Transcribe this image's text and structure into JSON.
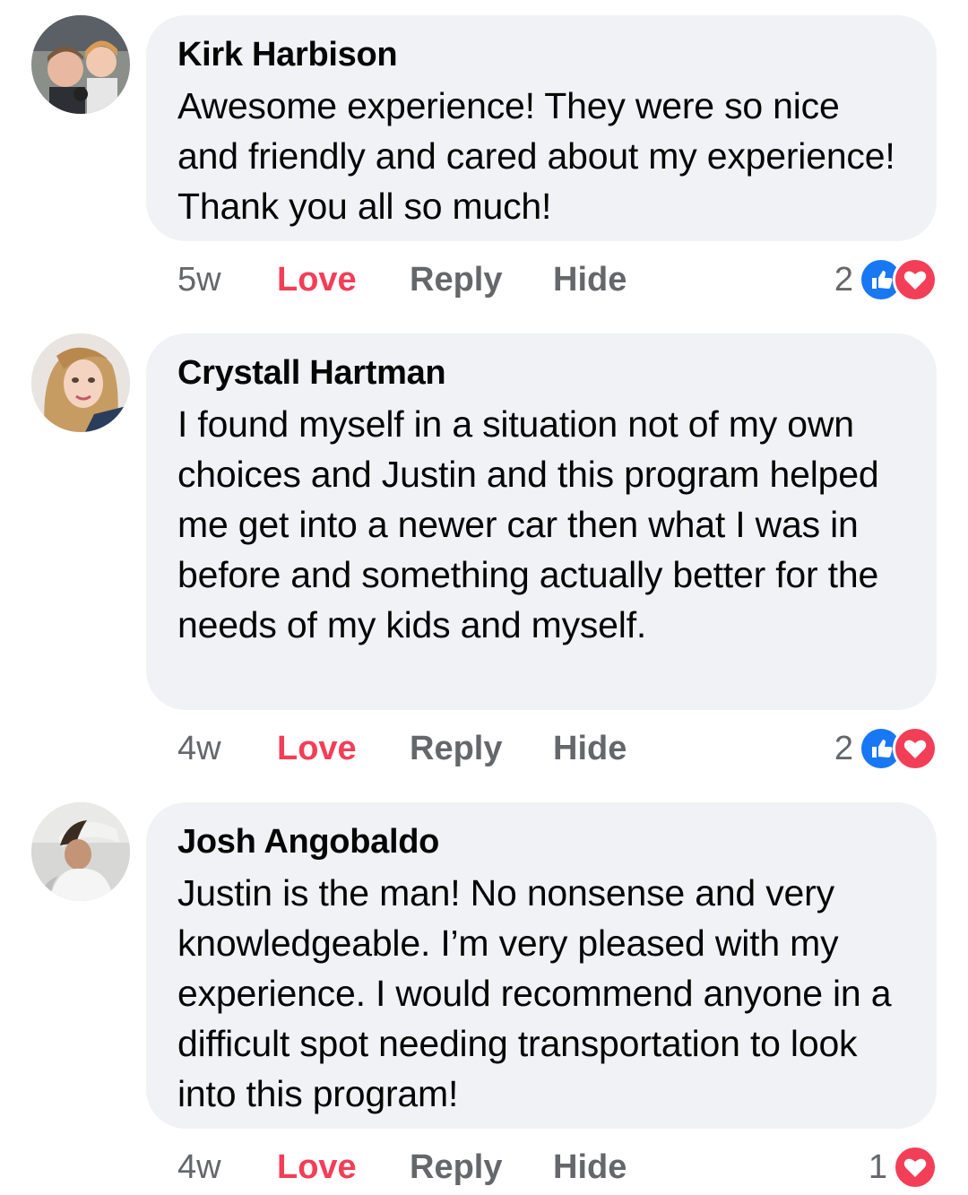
{
  "comments": [
    {
      "author": "Kirk Harbison",
      "text": "Awesome experience! They were so nice and friendly and cared about my experience! Thank you all so much!",
      "time": "5w",
      "love_label": "Love",
      "reply_label": "Reply",
      "hide_label": "Hide",
      "reaction_count": "2",
      "reactions": [
        "like-icon",
        "love-icon"
      ]
    },
    {
      "author": "Crystall Hartman",
      "text": "I found myself in a situation not of my own choices and Justin and this program helped me get into a newer car then what I was in before and something actually better for the needs of my kids and myself.",
      "time": "4w",
      "love_label": "Love",
      "reply_label": "Reply",
      "hide_label": "Hide",
      "reaction_count": "2",
      "reactions": [
        "like-icon",
        "love-icon"
      ]
    },
    {
      "author": "Josh Angobaldo",
      "text": "Justin is the man! No nonsense and very knowledgeable. I’m very pleased with my experience. I would recommend anyone in a difficult spot needing transportation to look into this program!",
      "time": "4w",
      "love_label": "Love",
      "reply_label": "Reply",
      "hide_label": "Hide",
      "reaction_count": "1",
      "reactions": [
        "love-icon"
      ]
    }
  ],
  "colors": {
    "bubble": "#f0f2f5",
    "love_text": "#f33e58",
    "meta_text": "#65676b",
    "like_blue": "#1877f2",
    "love_red": "#f33e58"
  }
}
